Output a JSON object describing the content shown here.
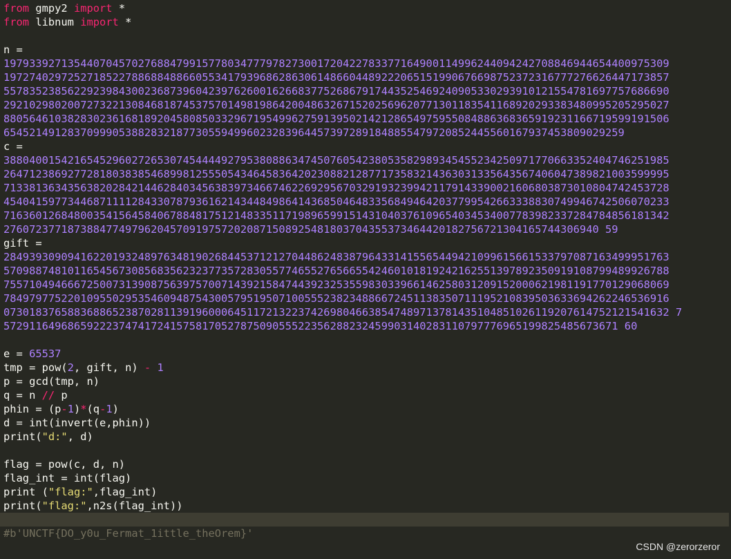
{
  "code": {
    "lines": [
      [
        {
          "t": "from",
          "c": "kw"
        },
        {
          "t": " gmpy2 ",
          "c": "fn"
        },
        {
          "t": "import",
          "c": "kw"
        },
        {
          "t": " *",
          "c": "fn"
        }
      ],
      [
        {
          "t": "from",
          "c": "kw"
        },
        {
          "t": " libnum ",
          "c": "fn"
        },
        {
          "t": "import",
          "c": "kw"
        },
        {
          "t": " *",
          "c": "fn"
        }
      ],
      [],
      [
        {
          "t": "n =",
          "c": "fn"
        }
      ],
      [
        {
          "t": "19793392713544070457027688479915778034777978273001720422783377164900114996244094242708846944654400975309",
          "c": "num"
        }
      ],
      [
        {
          "t": "19727402972527185227886884886605534179396862863061486604489222065151990676698752372316777276626447173857",
          "c": "num"
        }
      ],
      [
        {
          "t": "55783523856229239843002368739604239762600162668377526867917443525469240905330293910121554781697757686690",
          "c": "num"
        }
      ],
      [
        {
          "t": "29210298020072732213084681874537570149819864200486326715202569620771301183541168920293383480995205295027",
          "c": "num"
        }
      ],
      [
        {
          "t": "88056461038283023616818920458085033296719549962759139502142128654975955084886368365919231166719599191506",
          "c": "num"
        }
      ],
      [
        {
          "t": "6545214912837099905388283218773055949960232839644573972891848855479720852445560167937453809029259",
          "c": "num"
        }
      ],
      [
        {
          "t": "c =",
          "c": "fn"
        }
      ],
      [
        {
          "t": "38804001542165452960272653074544449279538088634745076054238053582989345455234250971770663352404746251985",
          "c": "num"
        }
      ],
      [
        {
          "t": "26471238692772818038385468998125550543464583642023088212877173583214363031335643567406047389821003599995",
          "c": "num"
        }
      ],
      [
        {
          "t": "71338136343563820284214462840345638397346674622692956703291932399421179143390021606803873010804742453728",
          "c": "num"
        }
      ],
      [
        {
          "t": "45404159773446871111284330787936162143448498641436850464833568494642037799542663338830749946742506070233",
          "c": "num"
        }
      ],
      [
        {
          "t": "71636012684800354156458406788481751214833511719896599151431040376109654034534007783982337284784856181342",
          "c": "num"
        }
      ],
      [
        {
          "t": "276072377187388477497962045709197572020871508925481803704355373464420182756721304165744306940 59",
          "c": "num"
        }
      ],
      [
        {
          "t": "gift =",
          "c": "fn"
        }
      ],
      [
        {
          "t": "28493930909416220193248976348190268445371212704486248387964331415565449421099615661533797087163499951763",
          "c": "num"
        }
      ],
      [
        {
          "t": "57098874810116545673085683562323773572830557746552765665542460101819242162551397892350919108799489926788",
          "c": "num"
        }
      ],
      [
        {
          "t": "75571049466672500731390875639757007143921584744392325355983033966146258031209152000621981191770129068069",
          "c": "num"
        }
      ],
      [
        {
          "t": "78497977522010955029535460948754300579519507100555238234886672451138350711195210839503633694262246536916",
          "c": "num"
        }
      ],
      [
        {
          "t": "07301837658836886523870281139196000645117213223742698046638547489713781435104851026119207614752121541632 7",
          "c": "num"
        }
      ],
      [
        {
          "t": "572911649686592223747417241575817052787509055522356288232459903140283110797776965199825485673671 60",
          "c": "num"
        }
      ],
      [],
      [
        {
          "t": "e = ",
          "c": "fn"
        },
        {
          "t": "65537",
          "c": "num"
        }
      ],
      [
        {
          "t": "tmp = pow(",
          "c": "fn"
        },
        {
          "t": "2",
          "c": "num"
        },
        {
          "t": ", gift, n) ",
          "c": "fn"
        },
        {
          "t": "-",
          "c": "kw"
        },
        {
          "t": " ",
          "c": "fn"
        },
        {
          "t": "1",
          "c": "num"
        }
      ],
      [
        {
          "t": "p = gcd(tmp, n)",
          "c": "fn"
        }
      ],
      [
        {
          "t": "q = n ",
          "c": "fn"
        },
        {
          "t": "//",
          "c": "kw"
        },
        {
          "t": " p",
          "c": "fn"
        }
      ],
      [
        {
          "t": "phin = (p",
          "c": "fn"
        },
        {
          "t": "-",
          "c": "kw"
        },
        {
          "t": "1",
          "c": "num"
        },
        {
          "t": ")",
          "c": "fn"
        },
        {
          "t": "*",
          "c": "kw"
        },
        {
          "t": "(q",
          "c": "fn"
        },
        {
          "t": "-",
          "c": "kw"
        },
        {
          "t": "1",
          "c": "num"
        },
        {
          "t": ")",
          "c": "fn"
        }
      ],
      [
        {
          "t": "d = int(invert(e,phin))",
          "c": "fn"
        }
      ],
      [
        {
          "t": "print(",
          "c": "fn"
        },
        {
          "t": "\"d:\"",
          "c": "str"
        },
        {
          "t": ", d)",
          "c": "fn"
        }
      ],
      [],
      [
        {
          "t": "flag = pow(c, d, n)",
          "c": "fn"
        }
      ],
      [
        {
          "t": "flag_int = int(flag)",
          "c": "fn"
        }
      ],
      [
        {
          "t": "print (",
          "c": "fn"
        },
        {
          "t": "\"flag:\"",
          "c": "str"
        },
        {
          "t": ",flag_int)",
          "c": "fn"
        }
      ],
      [
        {
          "t": "print(",
          "c": "fn"
        },
        {
          "t": "\"flag:\"",
          "c": "str"
        },
        {
          "t": ",n2s(flag_int))",
          "c": "fn"
        }
      ],
      [],
      [
        {
          "t": "#b'UNCTF{DO_y0u_Fermat_1ittle_theOrem}'",
          "c": "cmt"
        }
      ]
    ],
    "current_line": 37
  },
  "watermark": "CSDN @zerorzeror",
  "colors": {
    "background": "#272822",
    "keyword": "#f92672",
    "number": "#ae81ff",
    "string": "#e6db74",
    "comment": "#75715e",
    "text": "#f8f8f2"
  }
}
